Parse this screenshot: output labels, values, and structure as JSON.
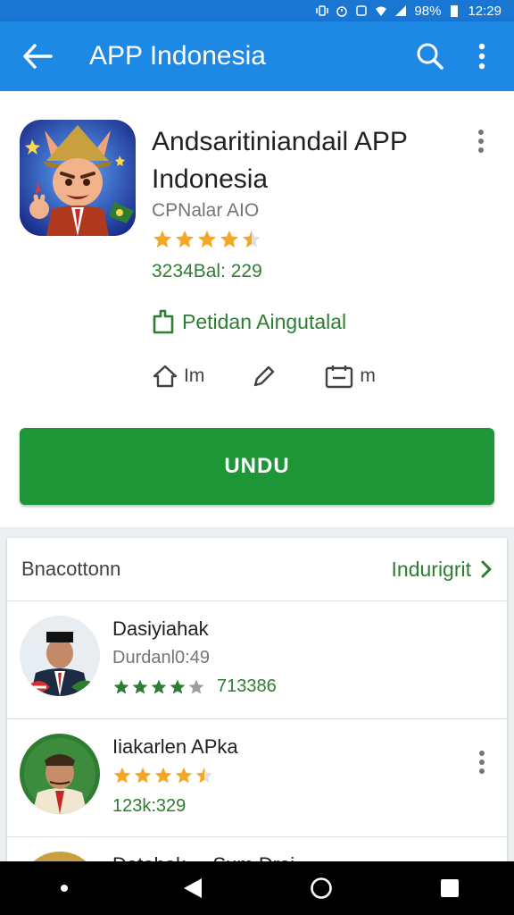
{
  "status_bar": {
    "battery": "98%",
    "time": "12:29"
  },
  "app_bar": {
    "title": "APP Indonesia"
  },
  "app": {
    "name": "Andsaritiniandail APP Indonesia",
    "developer": "CPNalar AIO",
    "rating": 4.5,
    "downloads": "3234Bal: 229",
    "editor_choice": "Petidan Aingutalal",
    "meta": [
      {
        "icon": "home-icon",
        "label": "Im"
      },
      {
        "icon": "pencil-icon",
        "label": ""
      },
      {
        "icon": "calendar-icon",
        "label": "m"
      }
    ],
    "install_label": "UNDU"
  },
  "section": {
    "title": "Bnacottonn",
    "see_more": "Indurigrit",
    "items": [
      {
        "name": "Dasiyiahak",
        "sub": "Durdanl0:49",
        "rating": 4.0,
        "rating_text": "713386"
      },
      {
        "name": "Iiakarlen APka",
        "rating": 4.5,
        "count": "123k:329"
      },
      {
        "name": "Datahak ... Sum Drai"
      }
    ]
  },
  "colors": {
    "primary": "#1e88e5",
    "status": "#1976d2",
    "install": "#1e9637",
    "accent_green": "#2e7d32",
    "star": "#f5a623"
  }
}
